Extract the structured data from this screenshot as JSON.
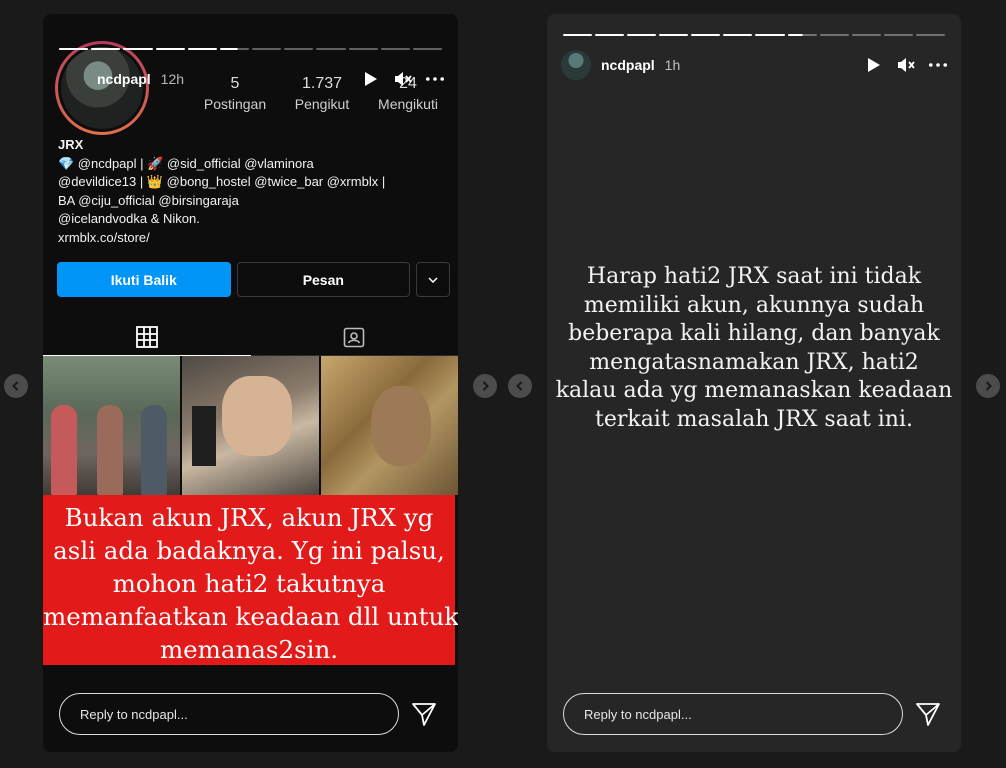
{
  "left_story": {
    "username": "ncdpapl",
    "time_ago": "12h",
    "progress": {
      "segments": 12,
      "current_index": 5,
      "current_fraction": 0.6
    },
    "profile_shot": {
      "stats": [
        {
          "num": "5",
          "label": "Postingan"
        },
        {
          "num": "1.737",
          "label": "Pengikut"
        },
        {
          "num": "24",
          "label": "Mengikuti"
        }
      ],
      "bio_name": "JRX",
      "bio_lines": [
        "💎 @ncdpapl | 🚀 @sid_official @vlaminora",
        "@devildice13 | 👑 @bong_hostel @twice_bar @xrmblx |",
        "BA @ciju_official @birsingaraja",
        "@icelandvodka & Nikon.",
        "xrmblx.co/store/"
      ],
      "follow_label": "Ikuti Balik",
      "message_label": "Pesan"
    },
    "caption_lines": [
      "Bukan akun JRX, akun JRX yg",
      "asli ada badaknya. Yg ini palsu,",
      "mohon hati2 takutnya",
      "memanfaatkan keadaan dll untuk",
      "memanas2sin."
    ],
    "reply_placeholder": "Reply to ncdpapl..."
  },
  "right_story": {
    "username": "ncdpapl",
    "time_ago": "1h",
    "progress": {
      "segments": 12,
      "current_index": 7,
      "current_fraction": 0.5
    },
    "text_lines": [
      "Harap hati2 JRX saat ini tidak",
      "memiliki akun, akunnya sudah",
      "beberapa kali hilang, dan banyak",
      "mengatasnamakan JRX, hati2",
      "kalau ada yg memanaskan keadaan",
      "terkait masalah JRX saat ini."
    ],
    "reply_placeholder": "Reply to ncdpapl..."
  },
  "icons": {
    "play": "play-icon",
    "mute": "mute-icon",
    "more": "more-icon",
    "send": "send-icon",
    "grid": "grid-icon",
    "tagged": "tagged-icon",
    "chevron_left": "chevron-left-icon",
    "chevron_right": "chevron-right-icon",
    "chevron_down": "chevron-down-icon"
  },
  "colors": {
    "follow_button": "#0095f6",
    "caption_background": "#e21a1a",
    "story_background": "#262626",
    "page_background": "#1a1a1a"
  }
}
